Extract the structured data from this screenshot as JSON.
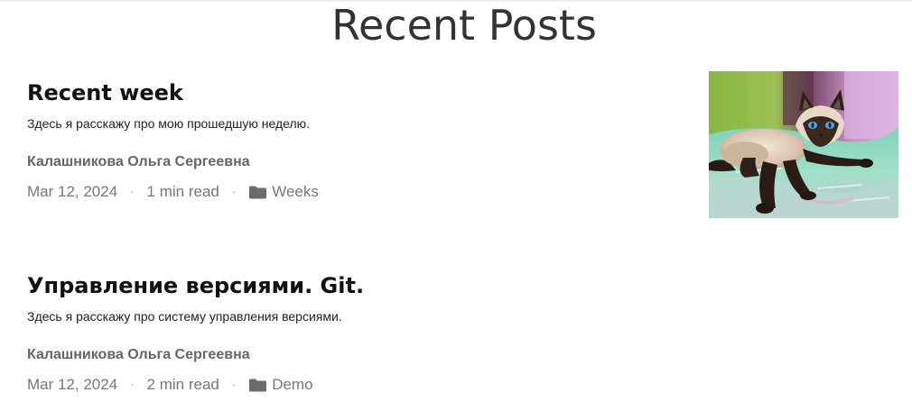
{
  "section": {
    "title": "Recent Posts"
  },
  "posts": [
    {
      "title": "Recent week",
      "excerpt": "Здесь я расскажу про мою прошедшую неделю.",
      "author": "Калашникова Ольга Сергеевна",
      "date": "Mar 12, 2024",
      "read_time": "1 min read",
      "separator": "·",
      "category": "Weeks",
      "category_icon": "folder-icon",
      "thumbnail": "siamese-cat-photo"
    },
    {
      "title": "Управление версиями. Git.",
      "excerpt": "Здесь я расскажу про систему управления версиями.",
      "author": "Калашникова Ольга Сергеевна",
      "date": "Mar 12, 2024",
      "read_time": "2 min read",
      "separator": "·",
      "category": "Demo",
      "category_icon": "folder-icon"
    }
  ],
  "colors": {
    "title_text": "#111111",
    "meta_text": "#777777",
    "author_text": "#666666"
  }
}
